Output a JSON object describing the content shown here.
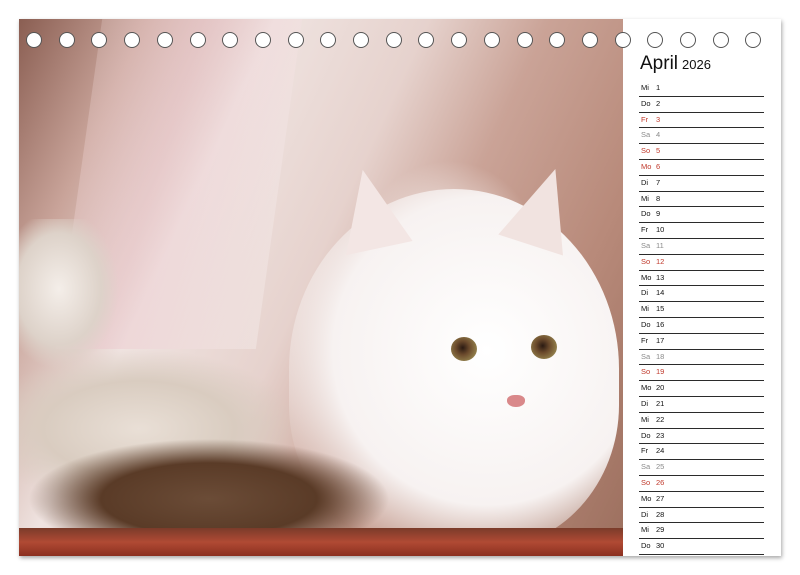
{
  "calendar": {
    "month": "April",
    "year": "2026",
    "days": [
      {
        "wd": "Mi",
        "d": "1",
        "type": "normal"
      },
      {
        "wd": "Do",
        "d": "2",
        "type": "normal"
      },
      {
        "wd": "Fr",
        "d": "3",
        "type": "sun"
      },
      {
        "wd": "Sa",
        "d": "4",
        "type": "sat"
      },
      {
        "wd": "So",
        "d": "5",
        "type": "sun"
      },
      {
        "wd": "Mo",
        "d": "6",
        "type": "sun"
      },
      {
        "wd": "Di",
        "d": "7",
        "type": "normal"
      },
      {
        "wd": "Mi",
        "d": "8",
        "type": "normal"
      },
      {
        "wd": "Do",
        "d": "9",
        "type": "normal"
      },
      {
        "wd": "Fr",
        "d": "10",
        "type": "normal"
      },
      {
        "wd": "Sa",
        "d": "11",
        "type": "sat"
      },
      {
        "wd": "So",
        "d": "12",
        "type": "sun"
      },
      {
        "wd": "Mo",
        "d": "13",
        "type": "normal"
      },
      {
        "wd": "Di",
        "d": "14",
        "type": "normal"
      },
      {
        "wd": "Mi",
        "d": "15",
        "type": "normal"
      },
      {
        "wd": "Do",
        "d": "16",
        "type": "normal"
      },
      {
        "wd": "Fr",
        "d": "17",
        "type": "normal"
      },
      {
        "wd": "Sa",
        "d": "18",
        "type": "sat"
      },
      {
        "wd": "So",
        "d": "19",
        "type": "sun"
      },
      {
        "wd": "Mo",
        "d": "20",
        "type": "normal"
      },
      {
        "wd": "Di",
        "d": "21",
        "type": "normal"
      },
      {
        "wd": "Mi",
        "d": "22",
        "type": "normal"
      },
      {
        "wd": "Do",
        "d": "23",
        "type": "normal"
      },
      {
        "wd": "Fr",
        "d": "24",
        "type": "normal"
      },
      {
        "wd": "Sa",
        "d": "25",
        "type": "sat"
      },
      {
        "wd": "So",
        "d": "26",
        "type": "sun"
      },
      {
        "wd": "Mo",
        "d": "27",
        "type": "normal"
      },
      {
        "wd": "Di",
        "d": "28",
        "type": "normal"
      },
      {
        "wd": "Mi",
        "d": "29",
        "type": "normal"
      },
      {
        "wd": "Do",
        "d": "30",
        "type": "normal"
      }
    ]
  },
  "colors": {
    "holiday": "#c0392b",
    "saturday": "#8a8a8a",
    "text": "#111111"
  },
  "photo": {
    "subject": "white-kitten-with-sandal"
  }
}
